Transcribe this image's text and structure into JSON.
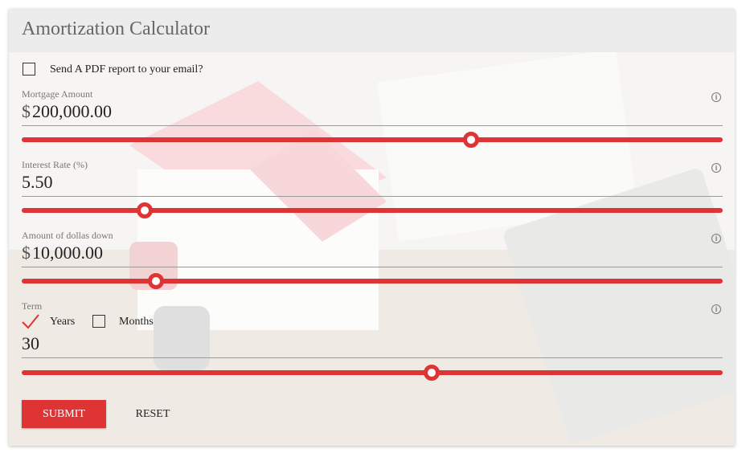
{
  "colors": {
    "accent": "#df3436",
    "header_bg": "#ececec",
    "text": "#222222",
    "muted": "#777777"
  },
  "header": {
    "title": "Amortization Calculator"
  },
  "email_option": {
    "label": "Send A PDF report to your email?",
    "checked": false
  },
  "mortgage": {
    "label": "Mortgage Amount",
    "currency": "$",
    "value": "200,000.00",
    "slider_fraction": 0.641
  },
  "interest": {
    "label": "Interest Rate (%)",
    "value": "5.50",
    "slider_fraction": 0.176
  },
  "down": {
    "label": "Amount of dollas down",
    "currency": "$",
    "value": "10,000.00",
    "slider_fraction": 0.192
  },
  "term": {
    "label": "Term",
    "years_label": "Years",
    "years_checked": true,
    "months_label": "Months",
    "months_checked": false,
    "value": "30",
    "slider_fraction": 0.585
  },
  "actions": {
    "submit_label": "SUBMIT",
    "reset_label": "RESET"
  },
  "icons": {
    "info": "info-icon",
    "check": "checkmark-icon"
  }
}
